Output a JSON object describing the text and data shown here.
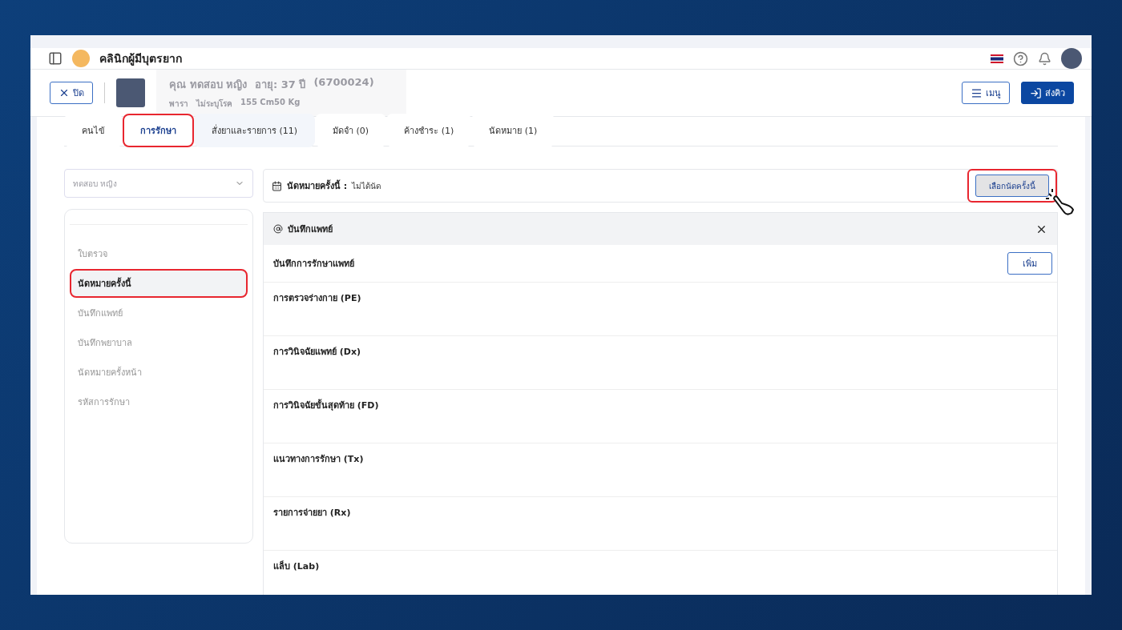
{
  "app": {
    "title": "คลินิกผู้มีบุตรยาก"
  },
  "patient": {
    "name": "คุณ ทดสอบ หญิง",
    "age": "อายุ: 37 ปี",
    "id": "(6700024)",
    "details": [
      "พารา",
      "ไม่ระบุโรค",
      "155 Cm50 Kg"
    ]
  },
  "header_buttons": [
    {
      "label": "ปิด",
      "kind": "close"
    }
  ],
  "actions": [
    {
      "label": "เมนู",
      "kind": "menu"
    },
    {
      "label": "ส่งคิว",
      "kind": "send"
    }
  ],
  "tabs": [
    {
      "label": "คนไข้",
      "selected": false,
      "highlighted": false
    },
    {
      "label": "การรักษา",
      "selected": true,
      "highlighted": true
    },
    {
      "label": "สั่งยาและรายการ (11)",
      "selected": false,
      "highlighted": false
    },
    {
      "label": "มัดจำ (0)",
      "selected": false,
      "highlighted": false
    },
    {
      "label": "ค้างชำระ (1)",
      "selected": false,
      "highlighted": false
    },
    {
      "label": "นัดหมาย (1)",
      "selected": false,
      "highlighted": false
    }
  ],
  "patient_select": {
    "placeholder": "ทดสอบ หญิง"
  },
  "sidebar": {
    "items": [
      {
        "label": "ใบตรวจ",
        "selected": false,
        "highlighted": false
      },
      {
        "label": "นัดหมายครั้งนี้",
        "selected": true,
        "highlighted": true
      },
      {
        "label": "บันทึกแพทย์",
        "selected": false,
        "highlighted": false
      },
      {
        "label": "บันทึกพยาบาล",
        "selected": false,
        "highlighted": false
      },
      {
        "label": "นัดหมายครั้งหน้า",
        "selected": false,
        "highlighted": false
      },
      {
        "label": "รหัสการรักษา",
        "selected": false,
        "highlighted": false
      }
    ]
  },
  "appointment": {
    "label": "นัดหมายครั้งนี้ :",
    "value": "ไม่ได้นัด",
    "button": "เลือกนัดครั้งนี้",
    "button_highlighted": true
  },
  "doctor_note": {
    "title": "บันทึกแพทย์",
    "subtitle": "บันทึกการรักษาแพทย์",
    "add_button": "เพิ่ม",
    "sections": [
      "การตรวจร่างกาย (PE)",
      "การวินิจฉัยแพทย์ (Dx)",
      "การวินิจฉัยขั้นสุดท้าย (FD)",
      "แนวทางการรักษา (Tx)",
      "รายการจ่ายยา (Rx)",
      "แล็บ (Lab)"
    ]
  }
}
